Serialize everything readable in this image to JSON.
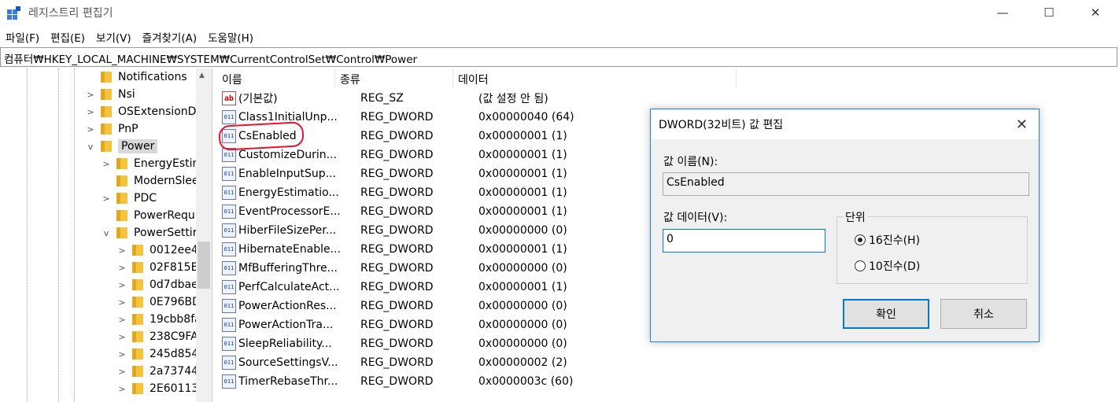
{
  "window": {
    "title": "레지스트리 편집기",
    "minimize": "—",
    "maximize": "☐",
    "close": "✕"
  },
  "menu": [
    "파일(F)",
    "편집(E)",
    "보기(V)",
    "즐겨찾기(A)",
    "도움말(H)"
  ],
  "address": "컴퓨터₩HKEY_LOCAL_MACHINE₩SYSTEM₩CurrentControlSet₩Control₩Power",
  "tree": [
    {
      "label": "Notifications",
      "expander": ""
    },
    {
      "label": "Nsi",
      "expander": ">"
    },
    {
      "label": "OSExtensionD",
      "expander": ">"
    },
    {
      "label": "PnP",
      "expander": ">"
    },
    {
      "label": "Power",
      "expander": "v"
    },
    {
      "label": "EnergyEstim",
      "expander": ">"
    },
    {
      "label": "ModernSlee",
      "expander": ""
    },
    {
      "label": "PDC",
      "expander": ">"
    },
    {
      "label": "PowerRequ",
      "expander": ""
    },
    {
      "label": "PowerSettir",
      "expander": "v"
    },
    {
      "label": "0012ee4",
      "expander": ">"
    },
    {
      "label": "02F815B",
      "expander": ">"
    },
    {
      "label": "0d7dbae",
      "expander": ">"
    },
    {
      "label": "0E796BD",
      "expander": ">"
    },
    {
      "label": "19cbb8fa",
      "expander": ">"
    },
    {
      "label": "238C9FA",
      "expander": ">"
    },
    {
      "label": "245d854",
      "expander": ">"
    },
    {
      "label": "2a73744",
      "expander": ">"
    },
    {
      "label": "2E60113",
      "expander": ">"
    }
  ],
  "list": {
    "headers": [
      "이름",
      "종류",
      "데이터"
    ],
    "rows": [
      {
        "name": "(기본값)",
        "type": "REG_SZ",
        "data": "(값 설정 안 됨)",
        "icon": "ab"
      },
      {
        "name": "Class1InitialUnp...",
        "type": "REG_DWORD",
        "data": "0x00000040 (64)",
        "icon": "dword"
      },
      {
        "name": "CsEnabled",
        "type": "REG_DWORD",
        "data": "0x00000001 (1)",
        "icon": "dword"
      },
      {
        "name": "CustomizeDurin...",
        "type": "REG_DWORD",
        "data": "0x00000001 (1)",
        "icon": "dword"
      },
      {
        "name": "EnableInputSup...",
        "type": "REG_DWORD",
        "data": "0x00000001 (1)",
        "icon": "dword"
      },
      {
        "name": "EnergyEstimatio...",
        "type": "REG_DWORD",
        "data": "0x00000001 (1)",
        "icon": "dword"
      },
      {
        "name": "EventProcessorE...",
        "type": "REG_DWORD",
        "data": "0x00000001 (1)",
        "icon": "dword"
      },
      {
        "name": "HiberFileSizePer...",
        "type": "REG_DWORD",
        "data": "0x00000000 (0)",
        "icon": "dword"
      },
      {
        "name": "HibernateEnable...",
        "type": "REG_DWORD",
        "data": "0x00000001 (1)",
        "icon": "dword"
      },
      {
        "name": "MfBufferingThre...",
        "type": "REG_DWORD",
        "data": "0x00000000 (0)",
        "icon": "dword"
      },
      {
        "name": "PerfCalculateAct...",
        "type": "REG_DWORD",
        "data": "0x00000001 (1)",
        "icon": "dword"
      },
      {
        "name": "PowerActionRes...",
        "type": "REG_DWORD",
        "data": "0x00000000 (0)",
        "icon": "dword"
      },
      {
        "name": "PowerActionTra...",
        "type": "REG_DWORD",
        "data": "0x00000000 (0)",
        "icon": "dword"
      },
      {
        "name": "SleepReliability...",
        "type": "REG_DWORD",
        "data": "0x00000000 (0)",
        "icon": "dword"
      },
      {
        "name": "SourceSettingsV...",
        "type": "REG_DWORD",
        "data": "0x00000002 (2)",
        "icon": "dword"
      },
      {
        "name": "TimerRebaseThr...",
        "type": "REG_DWORD",
        "data": "0x0000003c (60)",
        "icon": "dword"
      }
    ]
  },
  "dialog": {
    "title": "DWORD(32비트) 값 편집",
    "close": "✕",
    "value_name_label": "값 이름(N):",
    "value_name": "CsEnabled",
    "value_data_label": "값 데이터(V):",
    "value_data": "0",
    "base_label": "단위",
    "hex_label": "16진수(H)",
    "dec_label": "10진수(D)",
    "base_selected": "hex",
    "ok_label": "확인",
    "cancel_label": "취소"
  },
  "colors": {
    "annotation": "#e8142c",
    "dialog_border": "#1883d7",
    "folder": "#f5c342"
  }
}
